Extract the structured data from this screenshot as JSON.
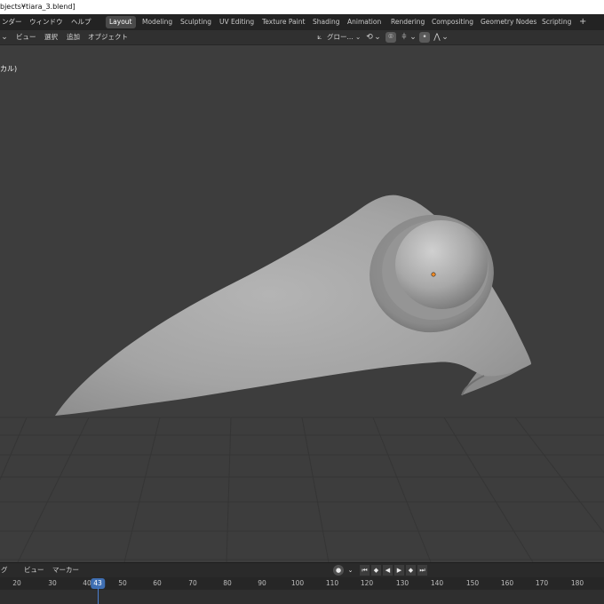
{
  "title_bar": {
    "text": "bjects¥tiara_3.blend]"
  },
  "top_menu": {
    "items": [
      "ンダー",
      "ウィンドウ",
      "ヘルプ"
    ],
    "workspace_tabs": [
      "Layout",
      "Modeling",
      "Sculpting",
      "UV Editing",
      "Texture Paint",
      "Shading",
      "Animation",
      "Rendering",
      "Compositing",
      "Geometry Nodes",
      "Scripting"
    ],
    "active_tab": "Layout",
    "add_tab": "+"
  },
  "viewport_header": {
    "collapse_icon": "chevron-down-icon",
    "menus": [
      "ビュー",
      "選択",
      "追加",
      "オブジェクト"
    ],
    "transform_orientation": "グロー...",
    "icons": [
      "transform-pivot-icon",
      "snap-icon",
      "proportional-edit-icon",
      "overlay-icon",
      "shading-icon"
    ]
  },
  "viewport": {
    "view_label": "カル)",
    "background_color": "#3d3d3d",
    "grid_color": "#353535",
    "object": "tiara",
    "origin_dot_color": "#f08a24"
  },
  "timeline": {
    "menus": [
      "グ",
      "ビュー",
      "マーカー"
    ],
    "record_icon": "record-icon",
    "playback_icons": [
      "jump-start-icon",
      "prev-keyframe-icon",
      "play-reverse-icon",
      "play-icon",
      "next-keyframe-icon",
      "jump-end-icon"
    ],
    "ticks": [
      "20",
      "30",
      "40",
      "50",
      "60",
      "70",
      "80",
      "90",
      "100",
      "110",
      "120",
      "130",
      "140",
      "150",
      "160",
      "170",
      "180"
    ],
    "current_frame": "43",
    "current_frame_color": "#3f6fb3"
  }
}
